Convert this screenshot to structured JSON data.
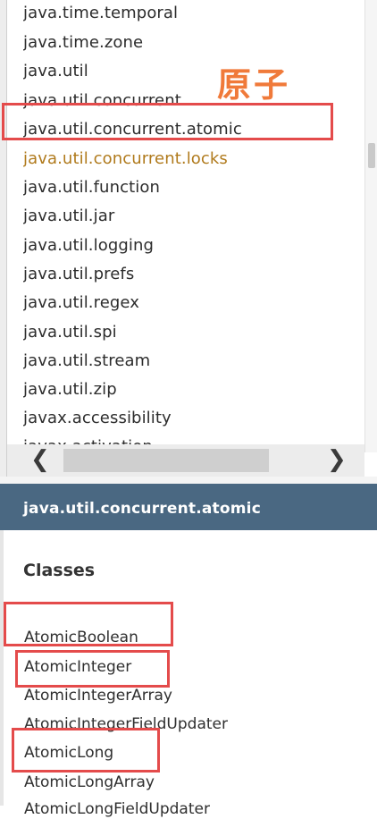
{
  "packages": [
    "java.time.temporal",
    "java.time.zone",
    "java.util",
    "java.util.concurrent",
    "java.util.concurrent.atomic",
    "java.util.concurrent.locks",
    "java.util.function",
    "java.util.jar",
    "java.util.logging",
    "java.util.prefs",
    "java.util.regex",
    "java.util.spi",
    "java.util.stream",
    "java.util.zip",
    "javax.accessibility",
    "javax.activation"
  ],
  "annotation": "原子",
  "scrollbar": {
    "left_arrow": "❮",
    "right_arrow": "❯"
  },
  "package_header": "java.util.concurrent.atomic",
  "classes_heading": "Classes",
  "classes": [
    "AtomicBoolean",
    "AtomicInteger",
    "AtomicIntegerArray",
    "AtomicIntegerFieldUpdater",
    "AtomicLong",
    "AtomicLongArray",
    "AtomicLongFieldUpdater"
  ],
  "colors": {
    "header_bg": "#4a6882",
    "visited_link": "#b07a1c",
    "highlight_box": "#e44b4b",
    "annotation": "#f07a3a"
  }
}
